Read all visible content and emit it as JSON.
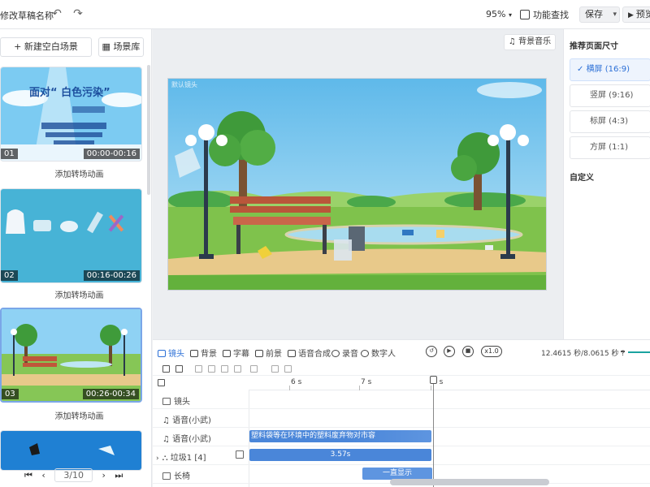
{
  "header": {
    "doc_title": "修改草稿名称",
    "undo_icon": "undo-icon",
    "redo_icon": "redo-icon",
    "zoom": "95%",
    "feature_find": "功能查找",
    "save": "保存",
    "preview": "预览"
  },
  "left_panel": {
    "new_scene": "+ 新建空白场景",
    "scene_library": "场景库",
    "scenes": [
      {
        "num": "01",
        "time": "00:00-00:16",
        "title_line": "面对“ 白色污染”"
      },
      {
        "num": "02",
        "time": "00:16-00:26"
      },
      {
        "num": "03",
        "time": "00:26-00:34"
      }
    ],
    "add_transition": "添加转场动画",
    "pagination": {
      "current": "3/10"
    }
  },
  "canvas": {
    "bgm_button": "背景音乐",
    "stage_label": "默认镜头"
  },
  "right_panel": {
    "title": "推荐页面尺寸",
    "sizes": [
      {
        "label": "横屏 (16:9)",
        "selected": true
      },
      {
        "label": "竖屏 (9:16)",
        "selected": false
      },
      {
        "label": "标屏 (4:3)",
        "selected": false
      },
      {
        "label": "方屏 (1:1)",
        "selected": false
      }
    ],
    "custom": "自定义"
  },
  "timeline": {
    "tabs": [
      "镜头",
      "背景",
      "字幕",
      "前景",
      "语音合成",
      "录音",
      "数字人"
    ],
    "speed": "x1.0",
    "duration": "12.4615 秒/8.0615 秒",
    "ticks": [
      "6 s",
      "7 s",
      "8 s"
    ],
    "tracks": [
      {
        "label": "镜头"
      },
      {
        "label": "语音(小武)"
      },
      {
        "label": "语音(小武)",
        "clip_text": "塑料袋等在环境中的塑料废弃物对市容"
      },
      {
        "label": "垃圾1 [4]",
        "clip_text": "3.57s"
      },
      {
        "label": "长椅",
        "clip_text": "一直显示"
      }
    ]
  },
  "colors": {
    "accent": "#2b6fd6",
    "clip_blue": "#4a86d9",
    "sky": "#6fc3ef",
    "grass": "#7fc24c"
  }
}
